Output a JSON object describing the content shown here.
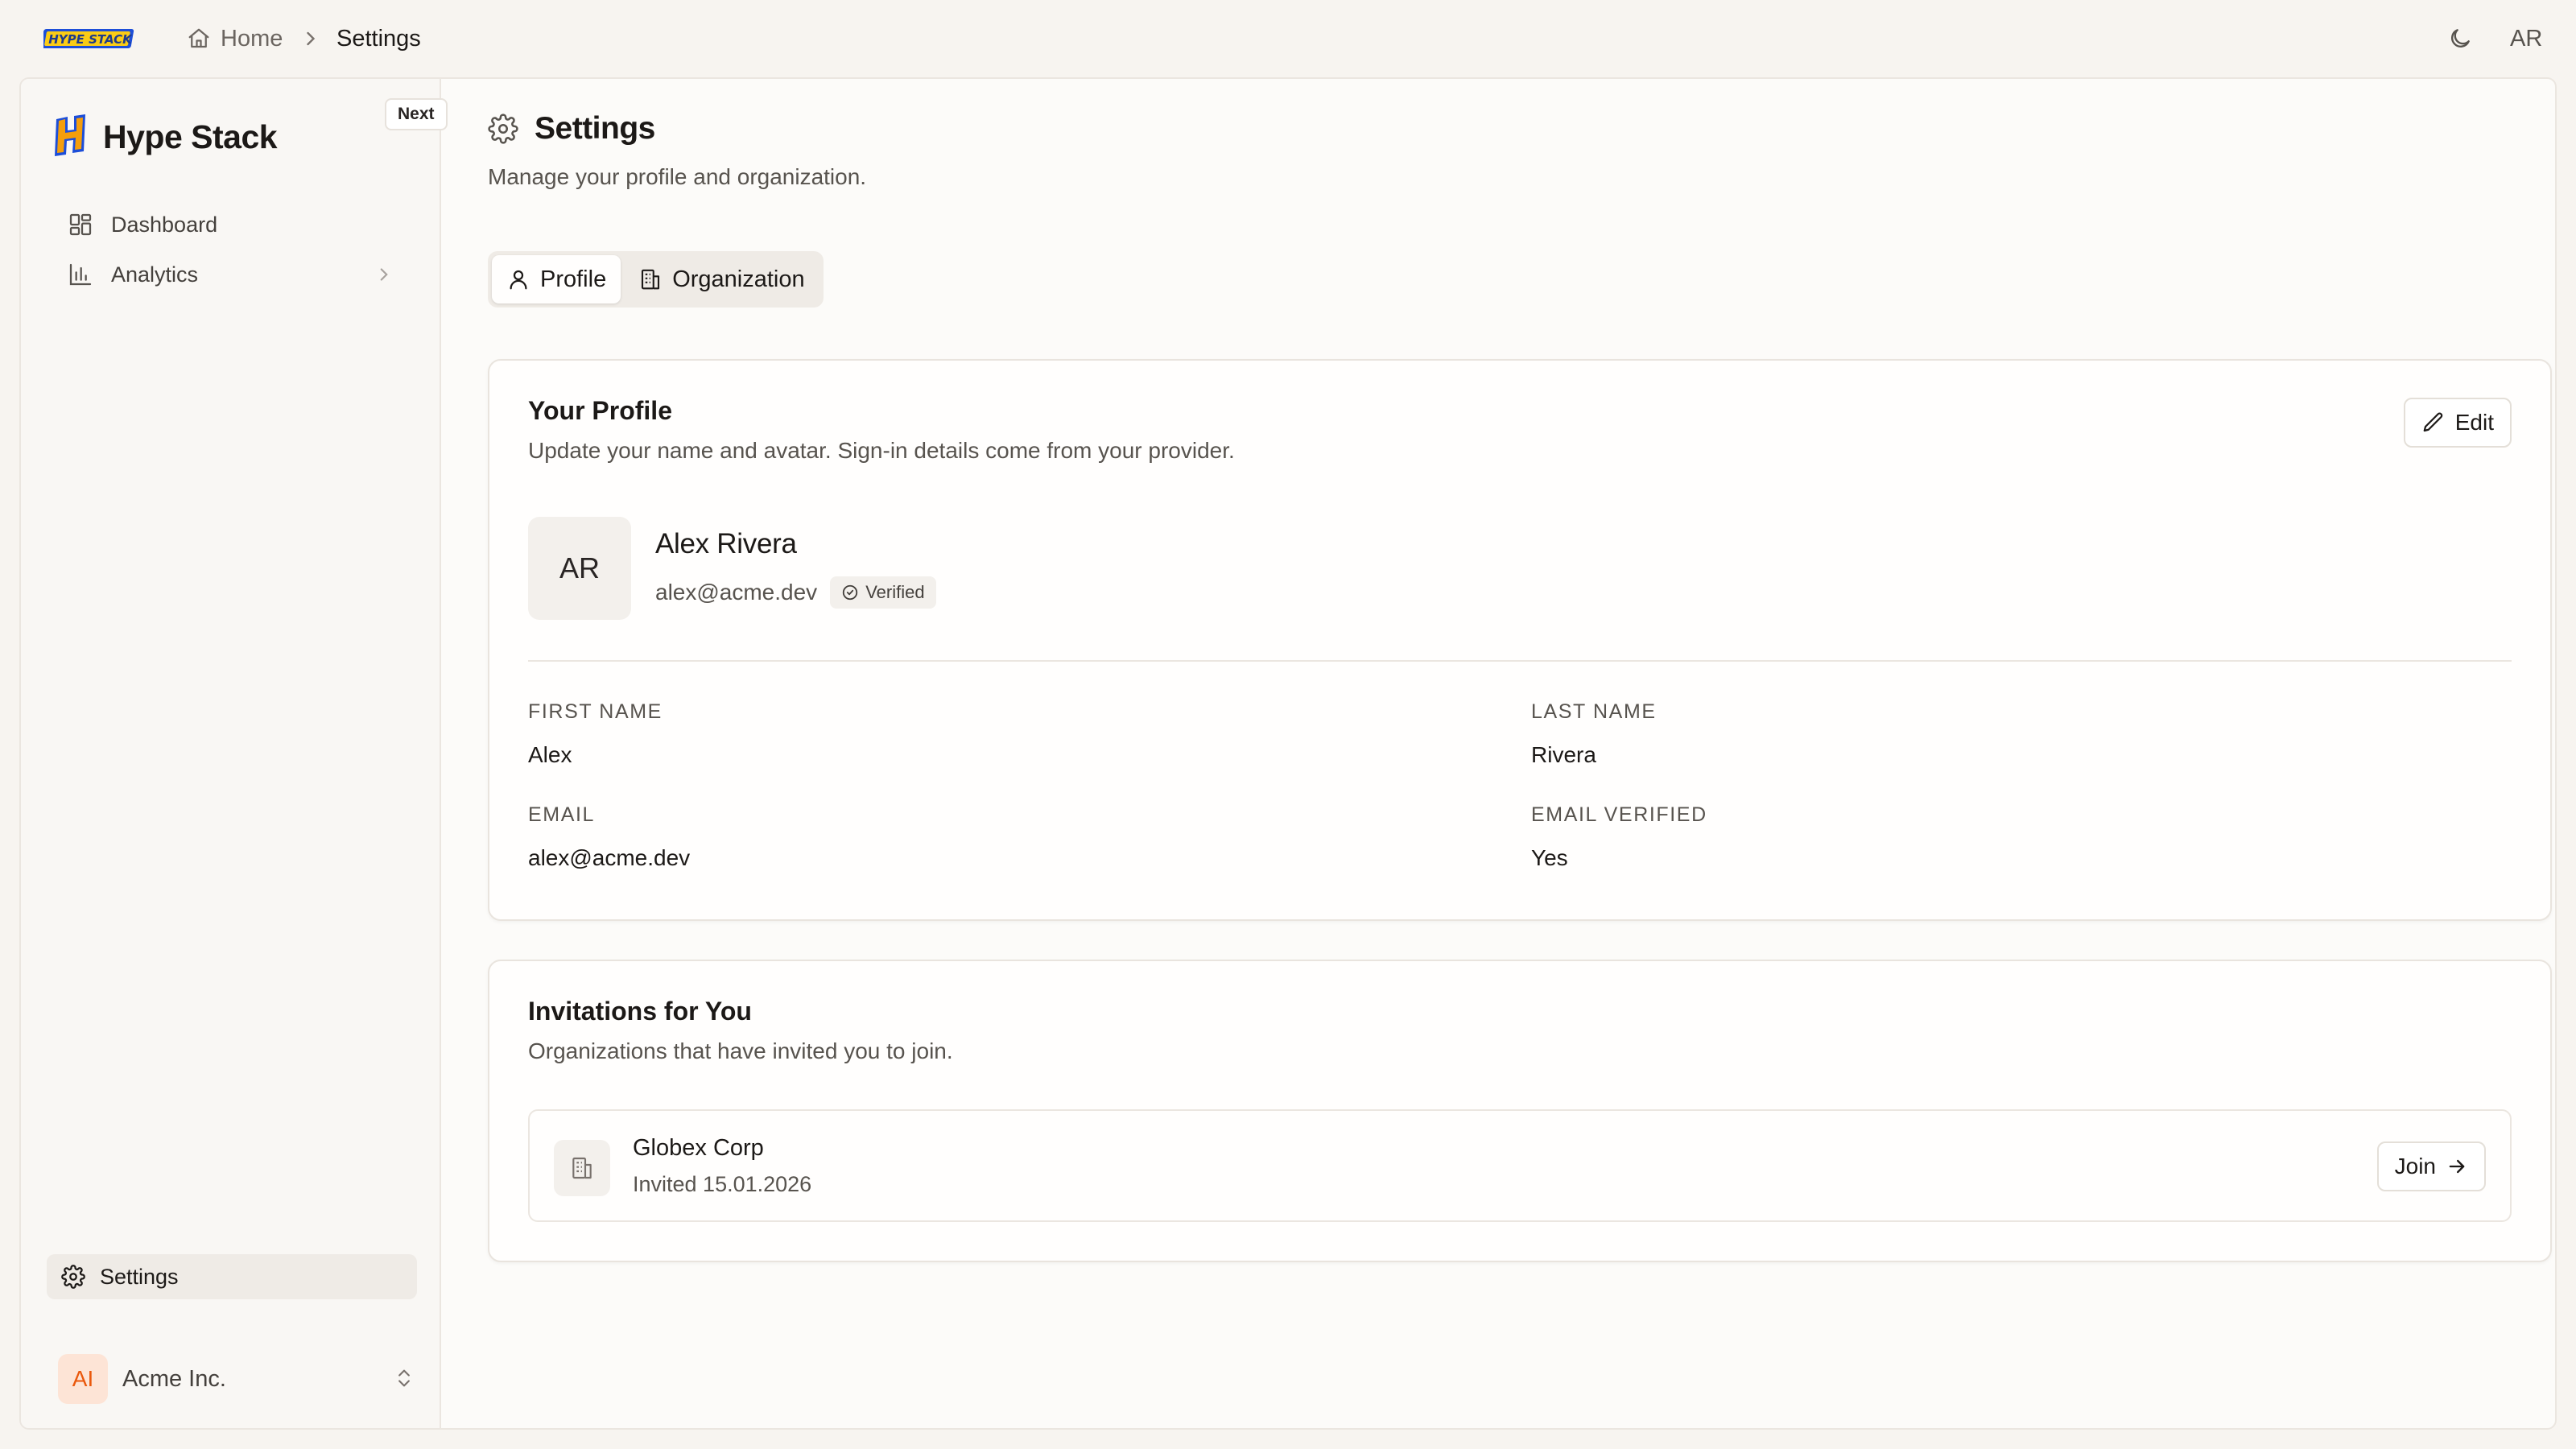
{
  "topbar": {
    "logo_text": "HYPE STACK",
    "breadcrumb": {
      "home": "Home",
      "current": "Settings"
    },
    "user_initials": "AR"
  },
  "sidebar": {
    "app_name": "Hype Stack",
    "badge": "Next",
    "items": [
      {
        "label": "Dashboard",
        "icon": "layout-grid-icon"
      },
      {
        "label": "Analytics",
        "icon": "bar-chart-icon"
      }
    ],
    "settings_label": "Settings",
    "org": {
      "initials": "AI",
      "name": "Acme Inc."
    }
  },
  "page": {
    "title": "Settings",
    "subtitle": "Manage your profile and organization.",
    "tabs": [
      {
        "label": "Profile",
        "active": true
      },
      {
        "label": "Organization",
        "active": false
      }
    ]
  },
  "profile_card": {
    "title": "Your Profile",
    "description": "Update your name and avatar. Sign-in details come from your provider.",
    "edit_label": "Edit",
    "avatar_initials": "AR",
    "name": "Alex Rivera",
    "email": "alex@acme.dev",
    "verified_label": "Verified",
    "fields": {
      "first_name": {
        "label": "FIRST NAME",
        "value": "Alex"
      },
      "last_name": {
        "label": "LAST NAME",
        "value": "Rivera"
      },
      "email": {
        "label": "EMAIL",
        "value": "alex@acme.dev"
      },
      "email_verified": {
        "label": "EMAIL VERIFIED",
        "value": "Yes"
      }
    }
  },
  "invites_card": {
    "title": "Invitations for You",
    "description": "Organizations that have invited you to join.",
    "items": [
      {
        "org": "Globex Corp",
        "date": "Invited 15.01.2026",
        "action": "Join"
      }
    ]
  },
  "colors": {
    "background": "#f7f4f0",
    "surface": "#fffefd",
    "border": "#e9e4de",
    "text": "#1c1917",
    "muted": "#57534e",
    "org_accent": "#ea580c"
  }
}
